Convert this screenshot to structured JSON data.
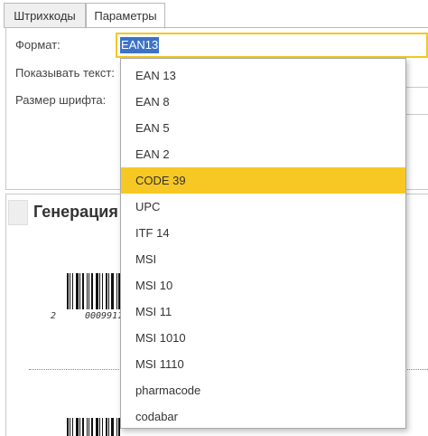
{
  "tabs": [
    {
      "label": "Штрихкоды"
    },
    {
      "label": "Параметры"
    }
  ],
  "form": {
    "format_label": "Формат:",
    "format_value": "EAN13",
    "show_text_label": "Показывать текст:",
    "font_size_label": "Размер шрифта:"
  },
  "generation": {
    "title": "Генерация штрихкодов"
  },
  "barcodes": [
    {
      "digit": "2",
      "number": "0009911"
    }
  ],
  "dropdown": {
    "selected": "CODE 39",
    "options": [
      "EAN 13",
      "EAN 8",
      "EAN 5",
      "EAN 2",
      "CODE 39",
      "UPC",
      "ITF 14",
      "MSI",
      "MSI 10",
      "MSI 11",
      "MSI 1010",
      "MSI 1110",
      "pharmacode",
      "codabar"
    ]
  },
  "colors": {
    "focus_border": "#f4c81f",
    "selected_item": "#f7c823",
    "text_selection": "#3c73c8"
  }
}
